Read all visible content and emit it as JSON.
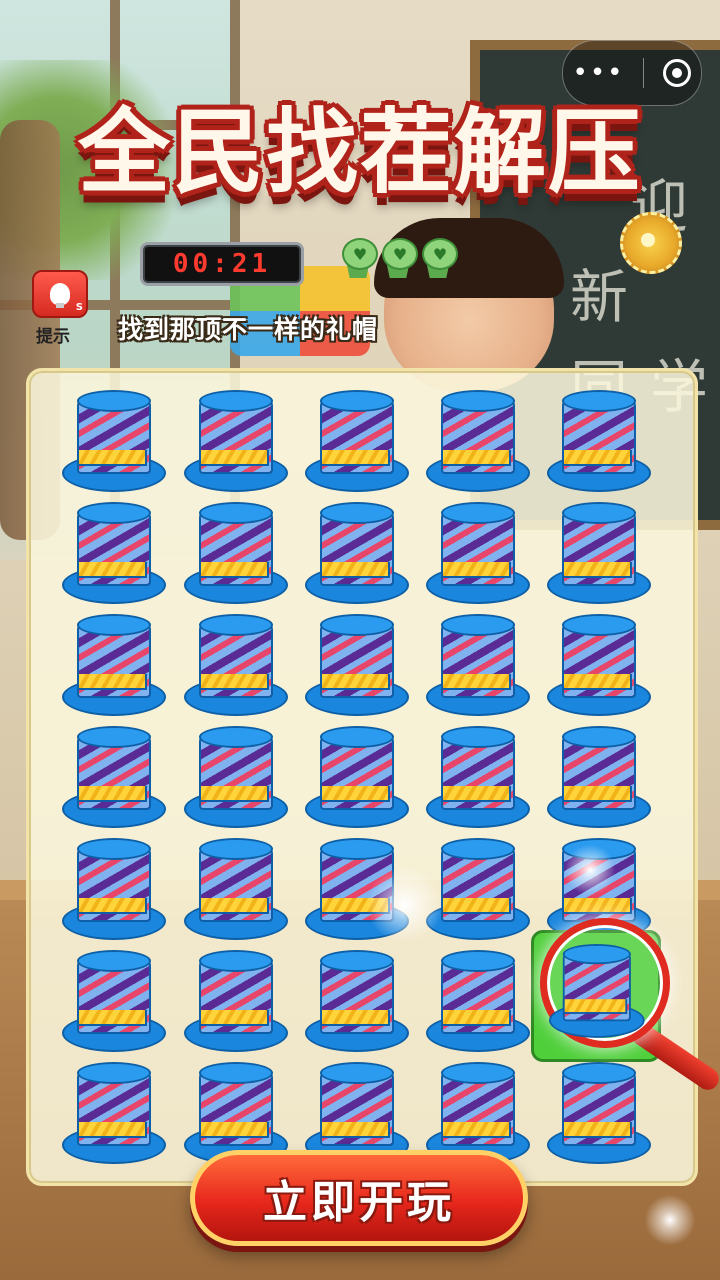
{
  "title": "全民找茬解压",
  "timer": "00:21",
  "lives_count": 3,
  "hint": {
    "label": "提示",
    "badge": "S",
    "icon": "lightbulb-icon"
  },
  "instruction": "找到那顶不一样的礼帽",
  "chalkboard": [
    "迎",
    "新",
    "同",
    "学"
  ],
  "grid": {
    "rows": 7,
    "cols": 5,
    "item": "top-hat",
    "target_row": 6,
    "target_col": 5
  },
  "cta_label": "立即开玩",
  "colors": {
    "title_red": "#b0231a",
    "hat_blue": "#1a86dd",
    "highlight_green": "#4fcf3a",
    "cta_red": "#e7271c"
  }
}
